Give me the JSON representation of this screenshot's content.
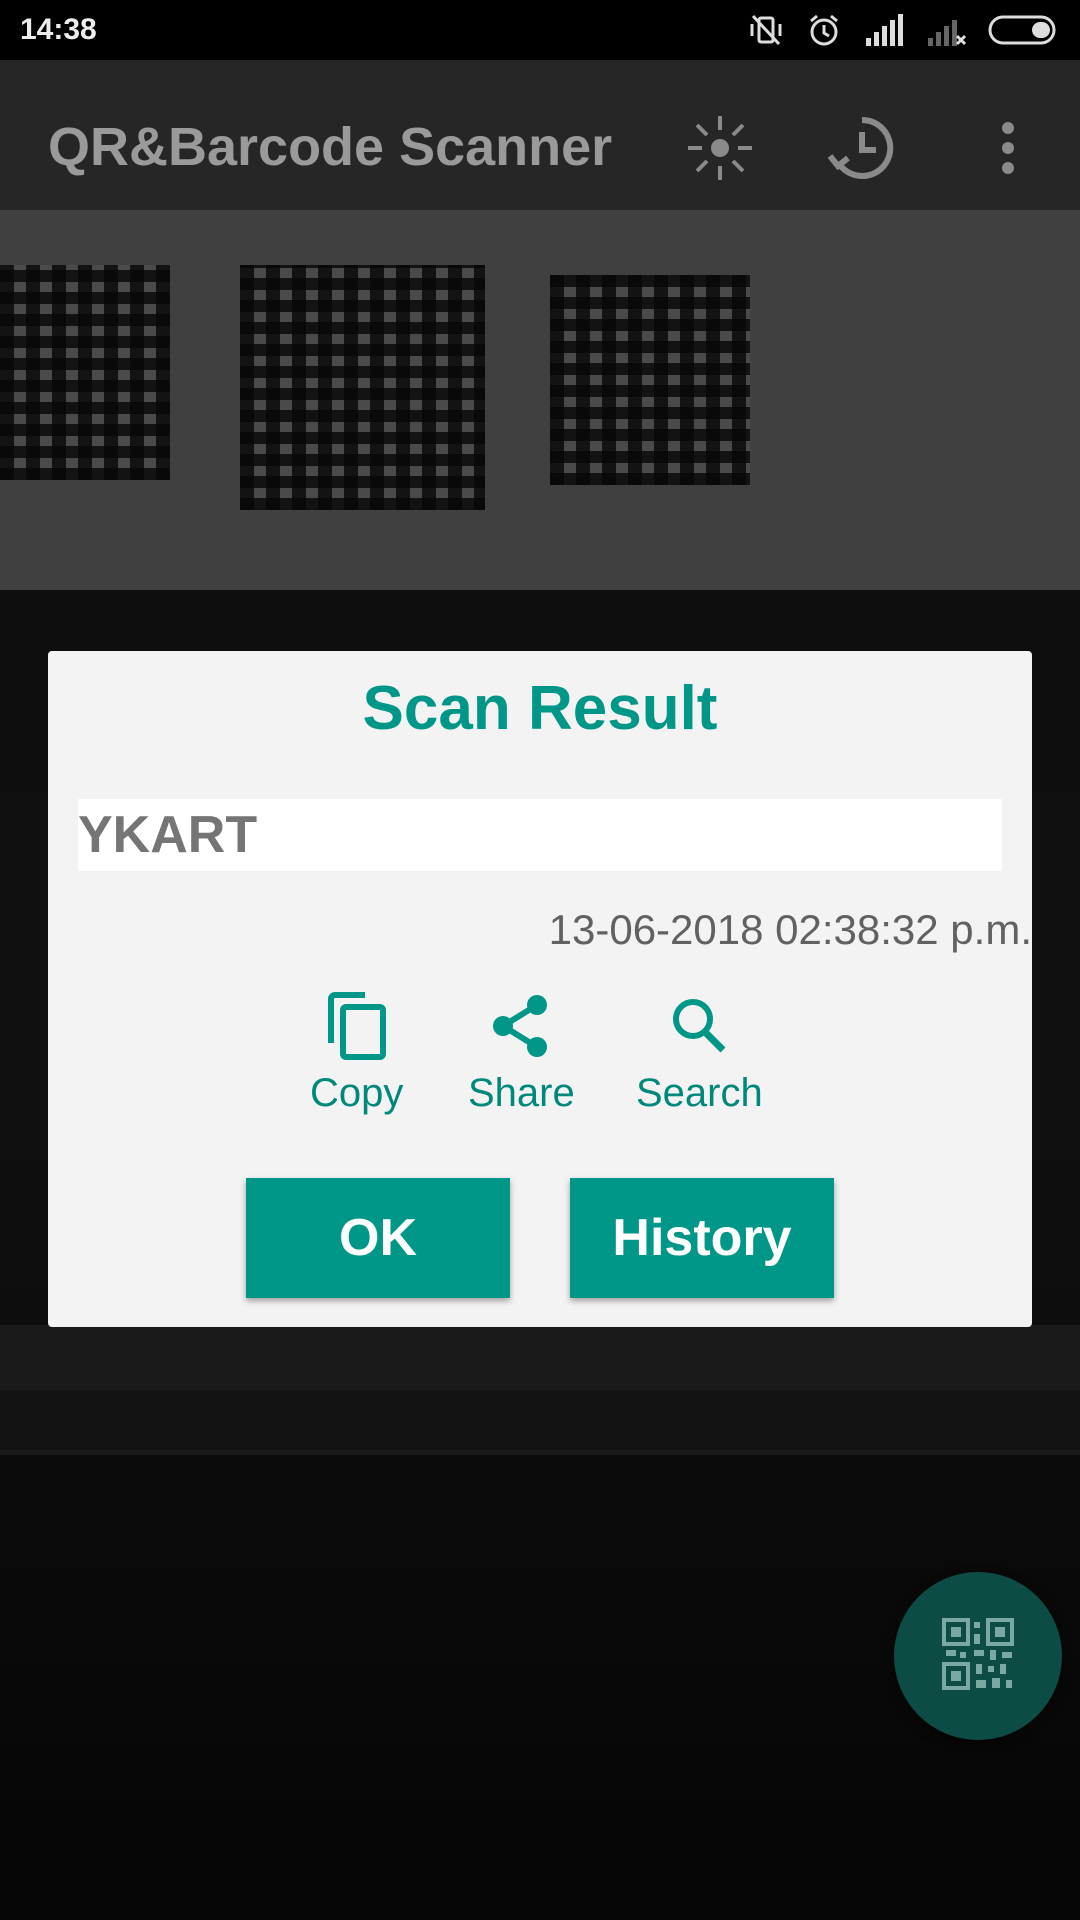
{
  "status_bar": {
    "time": "14:38",
    "icons": [
      "mute-vibrate-icon",
      "alarm-icon",
      "signal-icon",
      "no-signal-icon",
      "battery-icon"
    ]
  },
  "app_bar": {
    "title": "QR&Barcode Scanner",
    "actions": [
      "flash-icon",
      "history-icon",
      "overflow-menu-icon"
    ]
  },
  "dialog": {
    "title": "Scan Result",
    "result": "YKART",
    "timestamp": "13-06-2018 02:38:32 p.m.",
    "actions": [
      {
        "label": "Copy",
        "icon": "copy-icon"
      },
      {
        "label": "Share",
        "icon": "share-icon"
      },
      {
        "label": "Search",
        "icon": "search-icon"
      }
    ],
    "buttons": {
      "ok": "OK",
      "history": "History"
    }
  },
  "fab": {
    "icon": "qr-code-icon"
  },
  "colors": {
    "accent": "#009688",
    "dialog_bg": "#f3f3f3",
    "fab": "#0d4c45"
  }
}
